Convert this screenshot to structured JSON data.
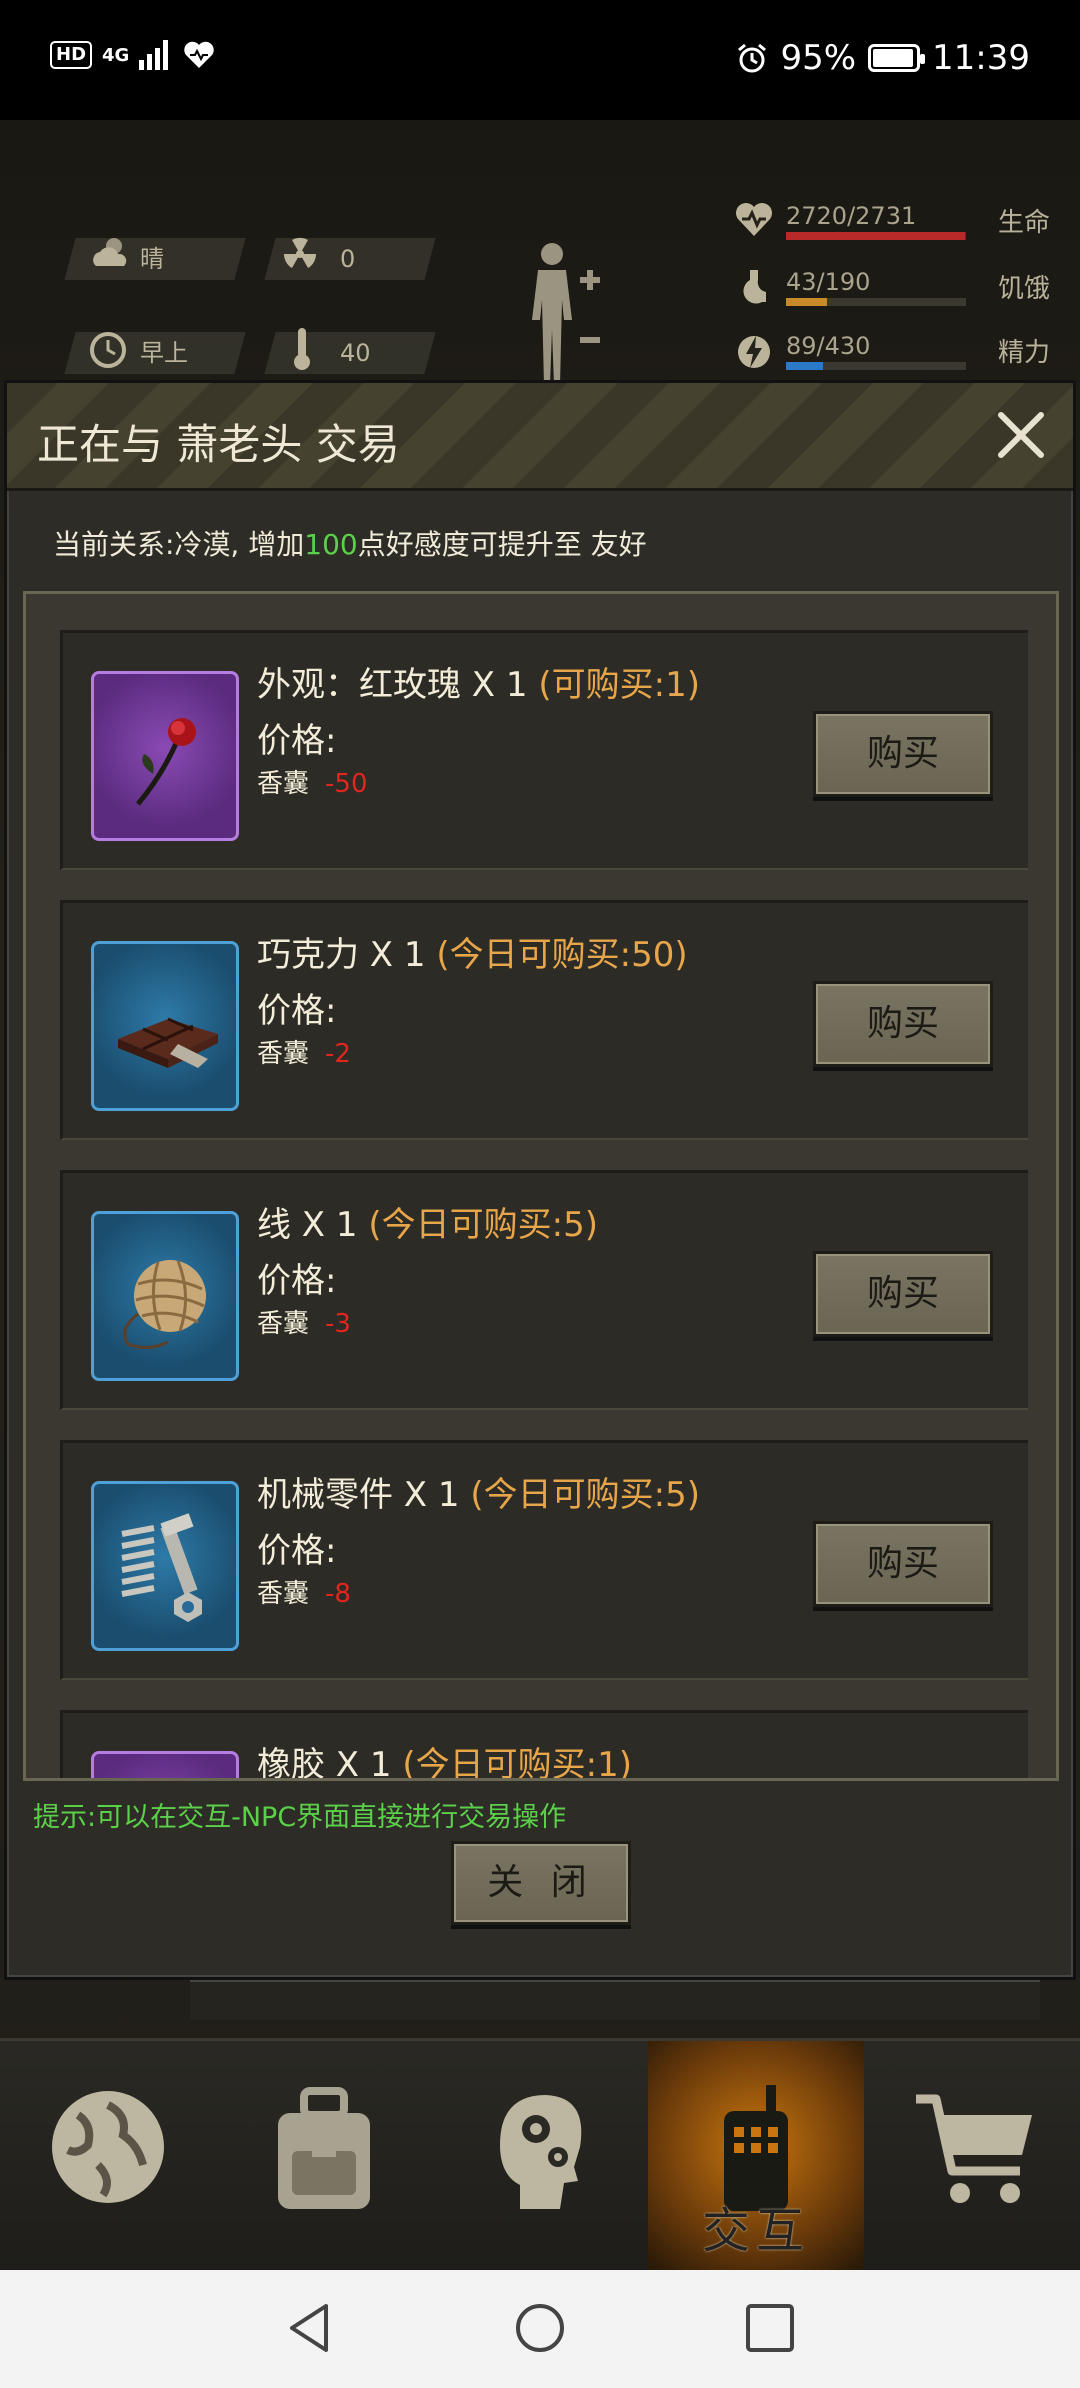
{
  "status_bar": {
    "hd": "HD",
    "network": "4G",
    "battery_percent": "95%",
    "battery_level": 0.95,
    "time": "11:39"
  },
  "hud": {
    "weather": "晴",
    "radiation": "0",
    "time_of_day": "早上",
    "temperature": "40",
    "stats": [
      {
        "value": "2720/2731",
        "label": "生命",
        "fraction": 0.996,
        "color": "#b82a2a"
      },
      {
        "value": "43/190",
        "label": "饥饿",
        "fraction": 0.226,
        "color": "#c98a2a"
      },
      {
        "value": "89/430",
        "label": "精力",
        "fraction": 0.207,
        "color": "#2a7ac9"
      }
    ]
  },
  "modal": {
    "title": "正在与 萧老头 交易",
    "relation_prefix": "当前关系:冷漠, 增加",
    "relation_points": "100",
    "relation_suffix": "点好感度可提升至 友好",
    "items": [
      {
        "name": "外观：红玫瑰 X 1",
        "limit": "(可购买:1)",
        "price_label": "价格:",
        "currency": "香囊",
        "cost": "-50",
        "buy": "购买",
        "icon": "rose-icon"
      },
      {
        "name": "巧克力 X 1",
        "limit": "(今日可购买:50)",
        "price_label": "价格:",
        "currency": "香囊",
        "cost": "-2",
        "buy": "购买",
        "icon": "chocolate-icon"
      },
      {
        "name": "线 X 1",
        "limit": "(今日可购买:5)",
        "price_label": "价格:",
        "currency": "香囊",
        "cost": "-3",
        "buy": "购买",
        "icon": "yarn-ball-icon"
      },
      {
        "name": "机械零件 X 1",
        "limit": "(今日可购买:5)",
        "price_label": "价格:",
        "currency": "香囊",
        "cost": "-8",
        "buy": "购买",
        "icon": "mechanical-parts-icon"
      },
      {
        "name": "橡胶 X 1",
        "limit": "(今日可购买:1)"
      }
    ],
    "hint": "提示:可以在交互-NPC界面直接进行交易操作",
    "close_label": "关 闭"
  },
  "bottom_nav": {
    "active_label": "交互",
    "items": [
      "globe-icon",
      "backpack-icon",
      "head-gears-icon",
      "walkie-talkie-icon",
      "cart-icon"
    ]
  }
}
